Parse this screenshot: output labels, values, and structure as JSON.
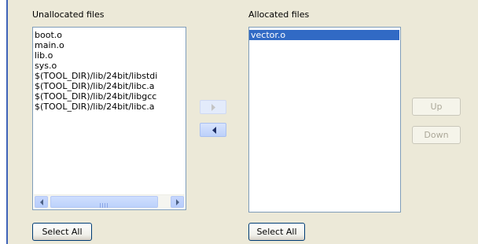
{
  "unallocated": {
    "label": "Unallocated files",
    "items": [
      "boot.o",
      "main.o",
      "lib.o",
      "sys.o",
      "$(TOOL_DIR)/lib/24bit/libstdi",
      "$(TOOL_DIR)/lib/24bit/libc.a",
      "$(TOOL_DIR)/lib/24bit/libgcc",
      "$(TOOL_DIR)/lib/24bit/libc.a"
    ],
    "select_all_label": "Select All"
  },
  "allocated": {
    "label": "Allocated files",
    "items": [
      "vector.o"
    ],
    "selected_index": 0,
    "select_all_label": "Select All"
  },
  "move_buttons": {
    "add_label": ">",
    "add_enabled": false,
    "remove_label": "<",
    "remove_enabled": true
  },
  "order_buttons": {
    "up_label": "Up",
    "down_label": "Down",
    "enabled": false
  },
  "icons": {
    "scroll_left": "scroll-left-arrow-icon",
    "scroll_right": "scroll-right-arrow-icon",
    "move_right": "move-right-arrow-icon",
    "move_left": "move-left-arrow-icon"
  },
  "colors": {
    "background": "#ece9d8",
    "list_border": "#7f9db9",
    "selection": "#316ac5",
    "accent_bar": "#3f63b8"
  }
}
